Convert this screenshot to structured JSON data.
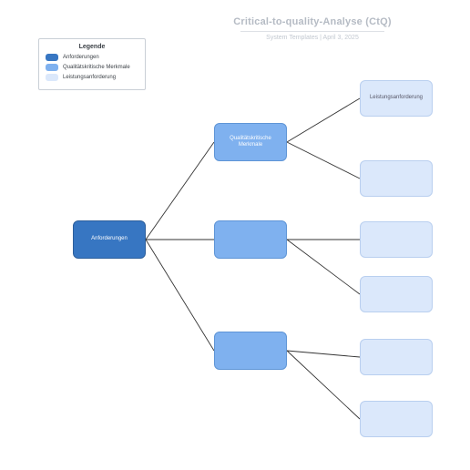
{
  "header": {
    "title": "Critical-to-quality-Analyse (CtQ)",
    "subtitle": "System Templates  |  April 3, 2025"
  },
  "legend": {
    "title": "Legende",
    "items": [
      {
        "label": "Anforderungen",
        "color": "#3776c2"
      },
      {
        "label": "Qualitätskritische Merkmale",
        "color": "#7fb1ef"
      },
      {
        "label": "Leistungsanforderung",
        "color": "#dbe8fb"
      }
    ]
  },
  "nodes": {
    "root": "Anforderungen",
    "q1": "Qualitätskritische Merkmale",
    "q2": "",
    "q3": "",
    "p1": "Leistungsanforderung",
    "p2": "",
    "p3": "",
    "p4": "",
    "p5": "",
    "p6": ""
  },
  "colors": {
    "dark": "#3776c2",
    "mid": "#7fb1ef",
    "light": "#dbe8fb"
  }
}
